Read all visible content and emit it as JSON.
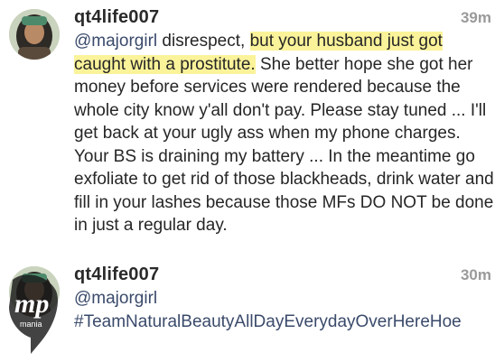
{
  "comments": [
    {
      "username": "qt4life007",
      "time": "39m",
      "mention": "@majorgirl",
      "text_before": " disrespect, ",
      "highlight": "but your husband just got caught with a prostitute.",
      "text_after": " She better hope she got her money before services were rendered because the whole city know y'all don't pay. Please stay tuned ... I'll get back at your ugly ass when my phone charges. Your BS is draining my battery ... In the meantime go exfoliate to get rid of those blackheads, drink water and fill in your lashes because those MFs DO NOT be done in just a regular day."
    },
    {
      "username": "qt4life007",
      "time": "30m",
      "mention": "@majorgirl",
      "hashtag": "#TeamNaturalBeautyAllDayEverydayOverHereHoe"
    }
  ],
  "watermark": {
    "logo_text": "mp",
    "sub_text": "mania"
  },
  "colors": {
    "highlight": "#fbf39a",
    "mention": "#3a4a6b",
    "text": "#262626",
    "timestamp": "#9a9a9a"
  }
}
